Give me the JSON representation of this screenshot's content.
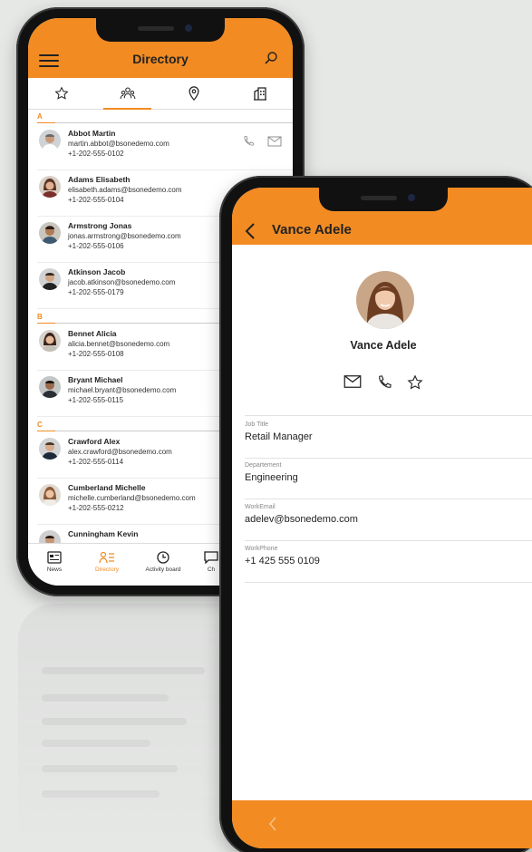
{
  "directory": {
    "title": "Directory",
    "sections": [
      {
        "letter": "A",
        "contacts": [
          {
            "name": "Abbot Martin",
            "email": "martin.abbot@bsonedemo.com",
            "phone": "+1-202-555-0102"
          },
          {
            "name": "Adams Elisabeth",
            "email": "elisabeth.adams@bsonedemo.com",
            "phone": "+1-202-555-0104"
          },
          {
            "name": "Armstrong Jonas",
            "email": "jonas.armstrong@bsonedemo.com",
            "phone": "+1-202-555-0106"
          },
          {
            "name": "Atkinson Jacob",
            "email": "jacob.atkinson@bsonedemo.com",
            "phone": "+1-202-555-0179"
          }
        ]
      },
      {
        "letter": "B",
        "contacts": [
          {
            "name": "Bennet Alicia",
            "email": "alicia.bennet@bsonedemo.com",
            "phone": "+1-202-555-0108"
          },
          {
            "name": "Bryant Michael",
            "email": "michael.bryant@bsonedemo.com",
            "phone": "+1-202-555-0115"
          }
        ]
      },
      {
        "letter": "C",
        "contacts": [
          {
            "name": "Crawford Alex",
            "email": "alex.crawford@bsonedemo.com",
            "phone": "+1-202-555-0114"
          },
          {
            "name": "Cumberland Michelle",
            "email": "michelle.cumberland@bsonedemo.com",
            "phone": "+1-202-555-0212"
          },
          {
            "name": "Cunningham Kevin",
            "email": "",
            "phone": ""
          }
        ]
      }
    ],
    "nav": [
      {
        "label": "News",
        "icon": "news-icon"
      },
      {
        "label": "Directory",
        "icon": "directory-icon",
        "active": true
      },
      {
        "label": "Activity board",
        "icon": "clock-icon"
      },
      {
        "label": "Ch",
        "icon": "chat-icon"
      }
    ],
    "tabs": [
      "star-icon",
      "people-icon",
      "location-pin-icon",
      "building-icon"
    ]
  },
  "profile": {
    "header_title": "Vance Adele",
    "name": "Vance Adele",
    "fields": [
      {
        "label": "Job Title",
        "value": "Retail Manager"
      },
      {
        "label": "Departement",
        "value": "Engineering"
      },
      {
        "label": "WorkEmail",
        "value": "adelev@bsonedemo.com"
      },
      {
        "label": "WorkPhone",
        "value": "+1 425 555 0109"
      }
    ]
  },
  "colors": {
    "accent": "#f28b22",
    "background": "#e6e8e6"
  }
}
